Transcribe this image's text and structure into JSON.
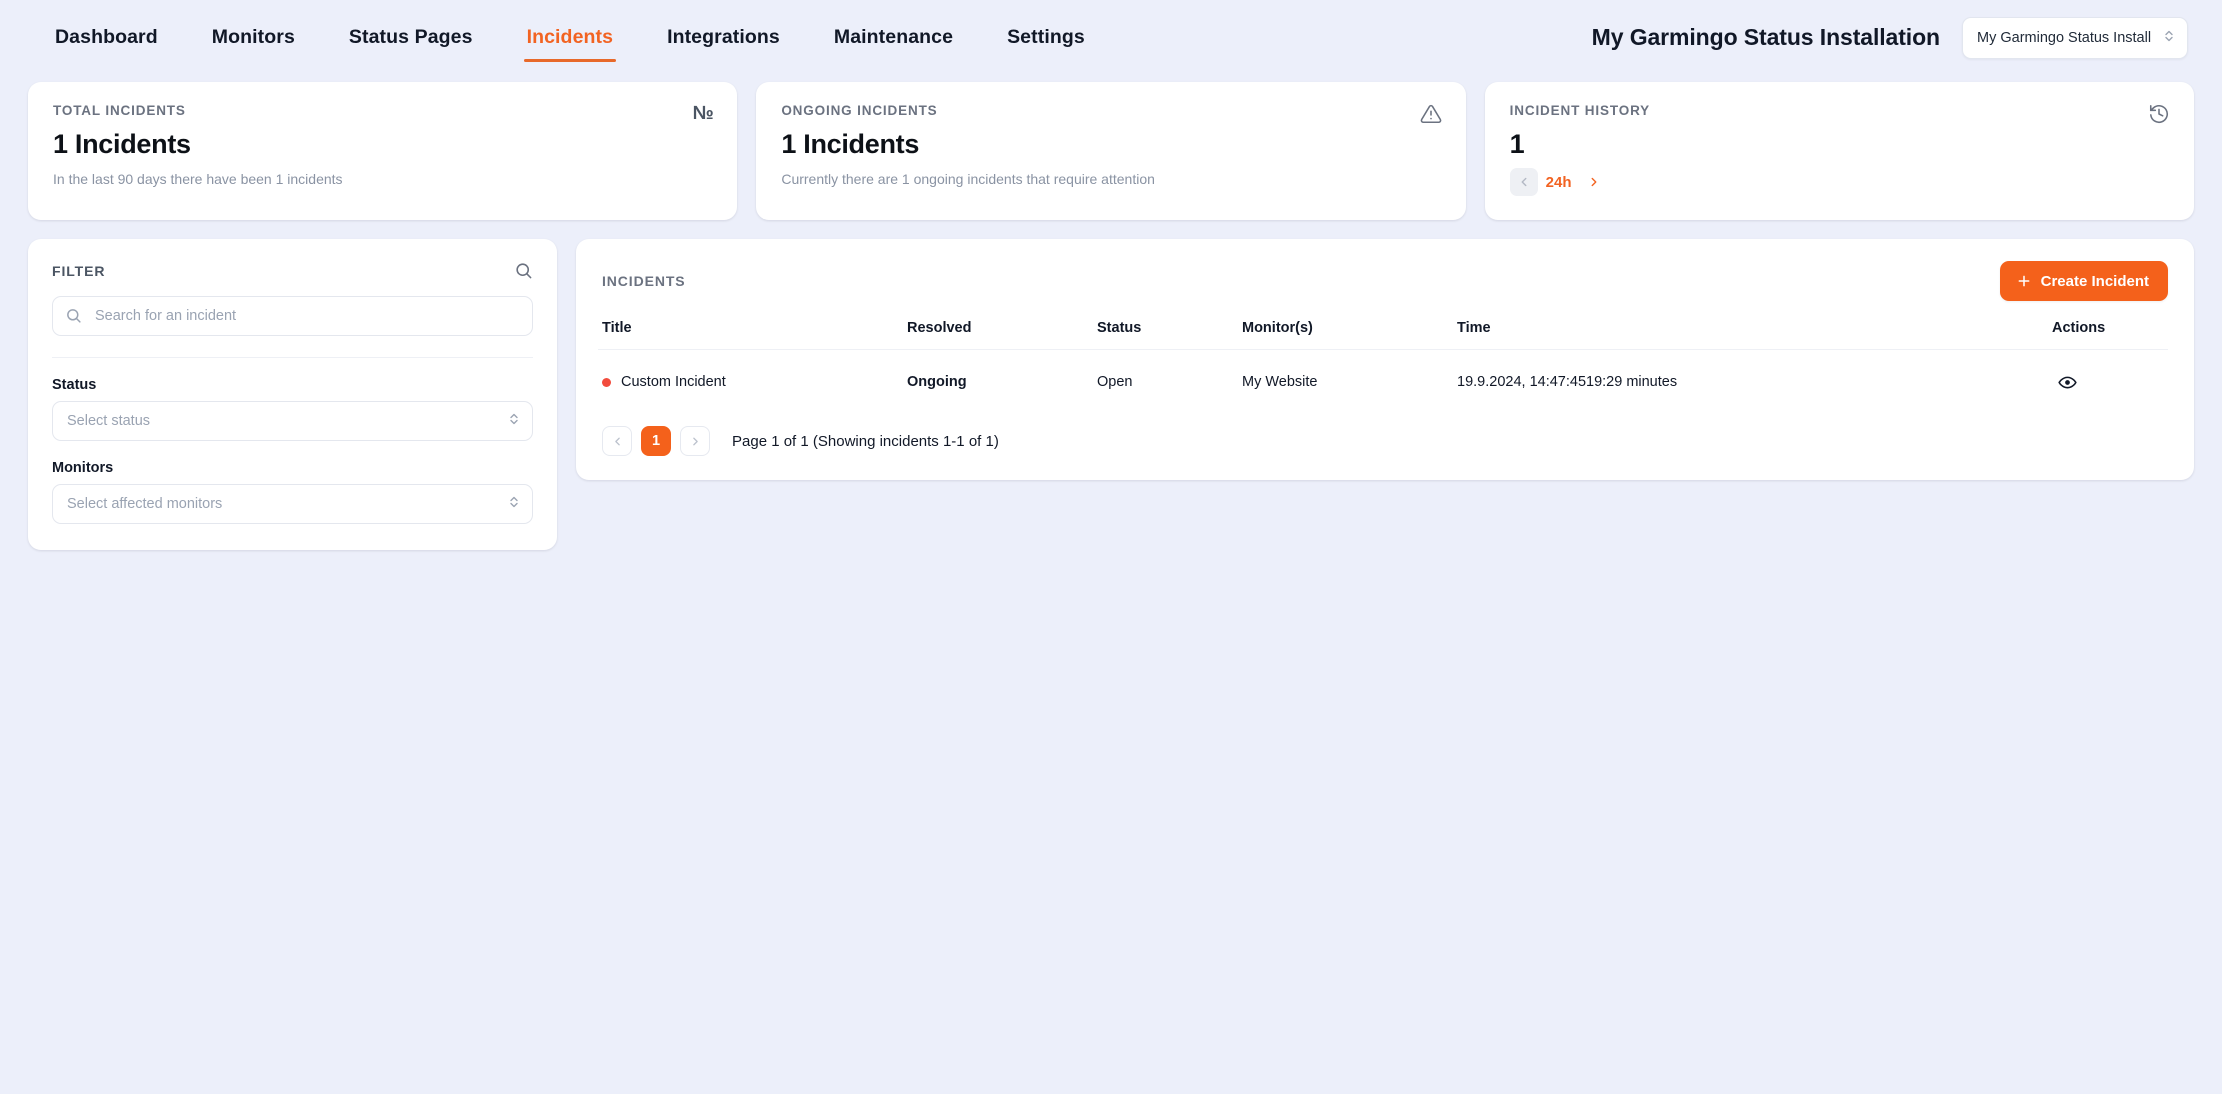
{
  "nav": {
    "items": [
      {
        "label": "Dashboard",
        "active": false
      },
      {
        "label": "Monitors",
        "active": false
      },
      {
        "label": "Status Pages",
        "active": false
      },
      {
        "label": "Incidents",
        "active": true
      },
      {
        "label": "Integrations",
        "active": false
      },
      {
        "label": "Maintenance",
        "active": false
      },
      {
        "label": "Settings",
        "active": false
      }
    ],
    "installation_title": "My Garmingo Status Installation",
    "installation_select_value": "My Garmingo Status Install"
  },
  "cards": {
    "total": {
      "label": "TOTAL INCIDENTS",
      "value": "1 Incidents",
      "sub": "In the last 90 days there have been 1 incidents",
      "icon": "number-sign-icon",
      "icon_glyph": "№"
    },
    "ongoing": {
      "label": "ONGOING INCIDENTS",
      "value": "1 Incidents",
      "sub": "Currently there are 1 ongoing incidents that require attention",
      "icon": "warning-triangle-icon"
    },
    "history": {
      "label": "INCIDENT HISTORY",
      "value": "1",
      "range": "24h",
      "icon": "history-clock-icon"
    }
  },
  "filter": {
    "title": "FILTER",
    "search_placeholder": "Search for an incident",
    "search_value": "",
    "status_label": "Status",
    "status_placeholder": "Select status",
    "monitors_label": "Monitors",
    "monitors_placeholder": "Select affected monitors"
  },
  "incidents": {
    "title": "INCIDENTS",
    "create_button": "Create Incident",
    "columns": [
      "Title",
      "Resolved",
      "Status",
      "Monitor(s)",
      "Time",
      "Actions"
    ],
    "rows": [
      {
        "title": "Custom Incident",
        "resolved": "Ongoing",
        "status": "Open",
        "monitors": "My Website",
        "time": "19.9.2024, 14:47:4519:29 minutes"
      }
    ],
    "pagination": {
      "current_page": "1",
      "summary": "Page 1 of 1 (Showing incidents 1-1 of 1)"
    }
  },
  "colors": {
    "accent": "#f4611b",
    "accent_text": "#f26322",
    "danger": "#f0493c",
    "page_bg": "#eceffa"
  }
}
